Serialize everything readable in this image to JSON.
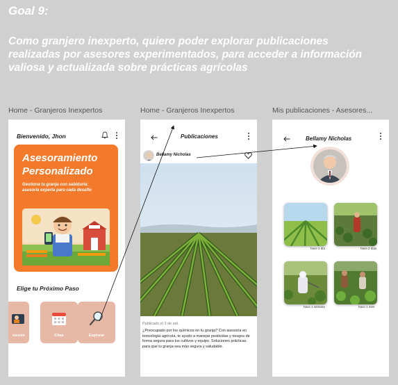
{
  "goal": {
    "title": "Goal 9:",
    "text": "Como granjero inexperto, quiero poder explorar publicaciones realizadas por asesores experimentados, para acceder a información valiosa y actualizada sobre prácticas agrícolas"
  },
  "frames": [
    {
      "label": "Home - Granjeros Inexpertos",
      "greeting": "Bienvenido, Jhon",
      "hero_title_1": "Asesoramiento",
      "hero_title_2": "Personalizado",
      "hero_sub": "Gestiona tu granja con sabiduría: asesoría experta para cada desafío",
      "section_title": "Elige tu Próximo Paso",
      "cards": [
        {
          "label": "esores",
          "icon": "advisor-icon"
        },
        {
          "label": "Citas",
          "icon": "calendar-icon"
        },
        {
          "label": "Explorar",
          "icon": "search-icon"
        }
      ]
    },
    {
      "label": "Home - Granjeros Inexpertos",
      "title": "Publicaciones",
      "author": "Bellamy Nicholas",
      "date": "Publicado el 3 de set.",
      "body": "¿Preocupado por los químicos en tu granja? Con asesoría en toxicología agrícola, te ayudo a manejar pesticidas y riesgos de forma segura para tus cultivos y equipo. Soluciones prácticas para que tu granja sea más segura y saludable."
    },
    {
      "label": "Mis publicaciones - Asesores...",
      "title": "Bellamy Nicholas",
      "posts": [
        {
          "caption": "hace 1 día"
        },
        {
          "caption": "hace 2 días"
        },
        {
          "caption": "hace 1 semana"
        },
        {
          "caption": "hace 1 mes"
        }
      ]
    }
  ],
  "colors": {
    "accent": "#f47a2b",
    "card": "#e8b8a6",
    "canvas": "#d0d0d0"
  }
}
